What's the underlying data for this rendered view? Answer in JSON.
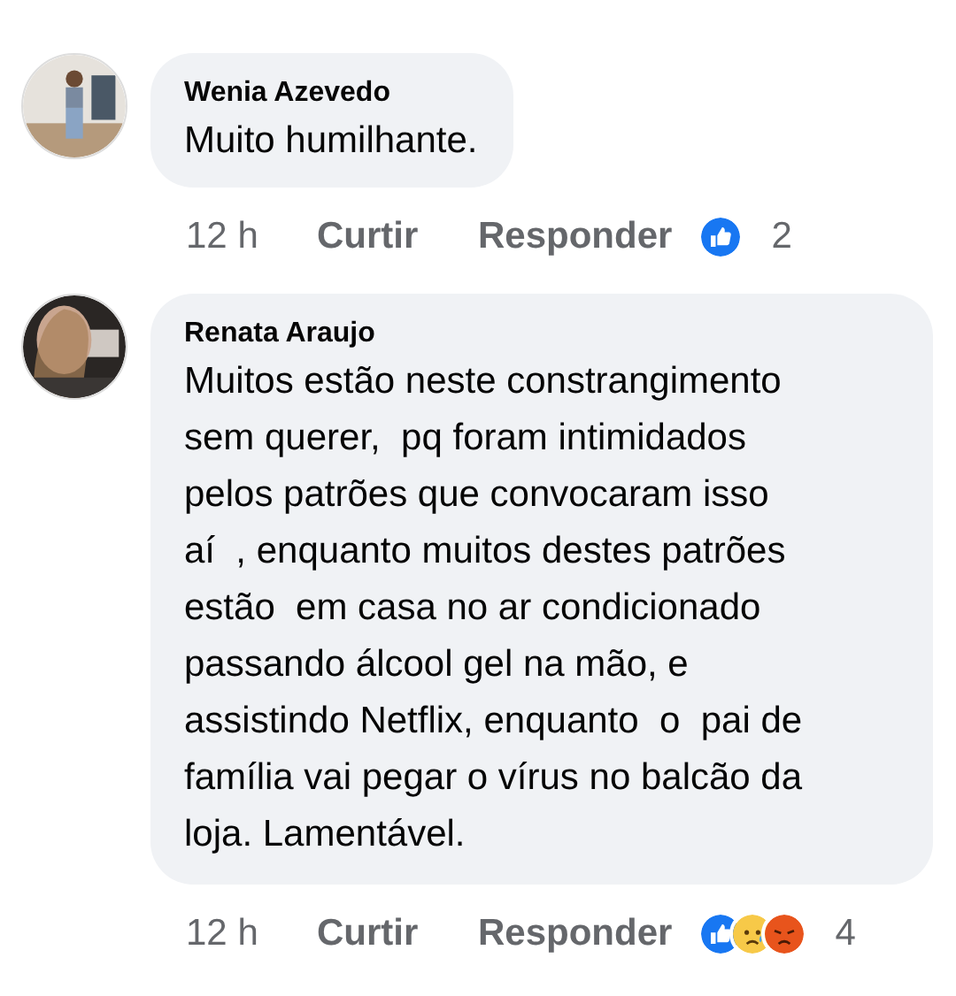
{
  "comments": [
    {
      "author": "Wenia Azevedo",
      "text": "Muito humilhante.",
      "avatar": {
        "kind": "picture"
      },
      "time": "12 h",
      "like": "Curtir",
      "reply": "Responder",
      "reactions": [
        {
          "kind": "like"
        }
      ],
      "count": "2"
    },
    {
      "author": "Renata Araujo",
      "text": "Muitos estão neste constrangimento\nsem querer,  pq foram intimidados\npelos patrões que convocaram isso\naí  , enquanto muitos destes patrões\nestão  em casa no ar condicionado\npassando álcool gel na mão, e\nassistindo Netflix, enquanto  o  pai de\nfamília vai pegar o vírus no balcão da\nloja. Lamentável.",
      "avatar": {
        "kind": "picture"
      },
      "time": "12 h",
      "like": "Curtir",
      "reply": "Responder",
      "reactions": [
        {
          "kind": "like"
        },
        {
          "kind": "sad"
        },
        {
          "kind": "angry"
        }
      ],
      "count": "4"
    }
  ]
}
